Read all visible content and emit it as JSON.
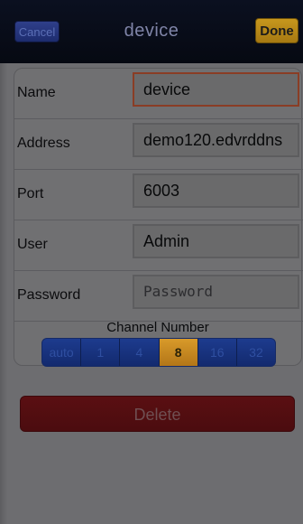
{
  "nav": {
    "cancel_label": "Cancel",
    "title": "device",
    "done_label": "Done"
  },
  "form": {
    "name": {
      "label": "Name",
      "value": "device"
    },
    "address": {
      "label": "Address",
      "value": "demo120.edvrddns"
    },
    "port": {
      "label": "Port",
      "value": "6003"
    },
    "user": {
      "label": "User",
      "value": "Admin"
    },
    "password": {
      "label": "Password",
      "placeholder": "Password"
    }
  },
  "channels": {
    "title": "Channel Number",
    "options": [
      "auto",
      "1",
      "4",
      "8",
      "16",
      "32"
    ],
    "selected": "8"
  },
  "actions": {
    "delete_label": "Delete"
  },
  "colors": {
    "done_bg": "#b98716",
    "cancel_bg": "#27367d",
    "delete_bg": "#541015",
    "segment_bg": "#193480",
    "segment_selected": "#c8891f"
  }
}
